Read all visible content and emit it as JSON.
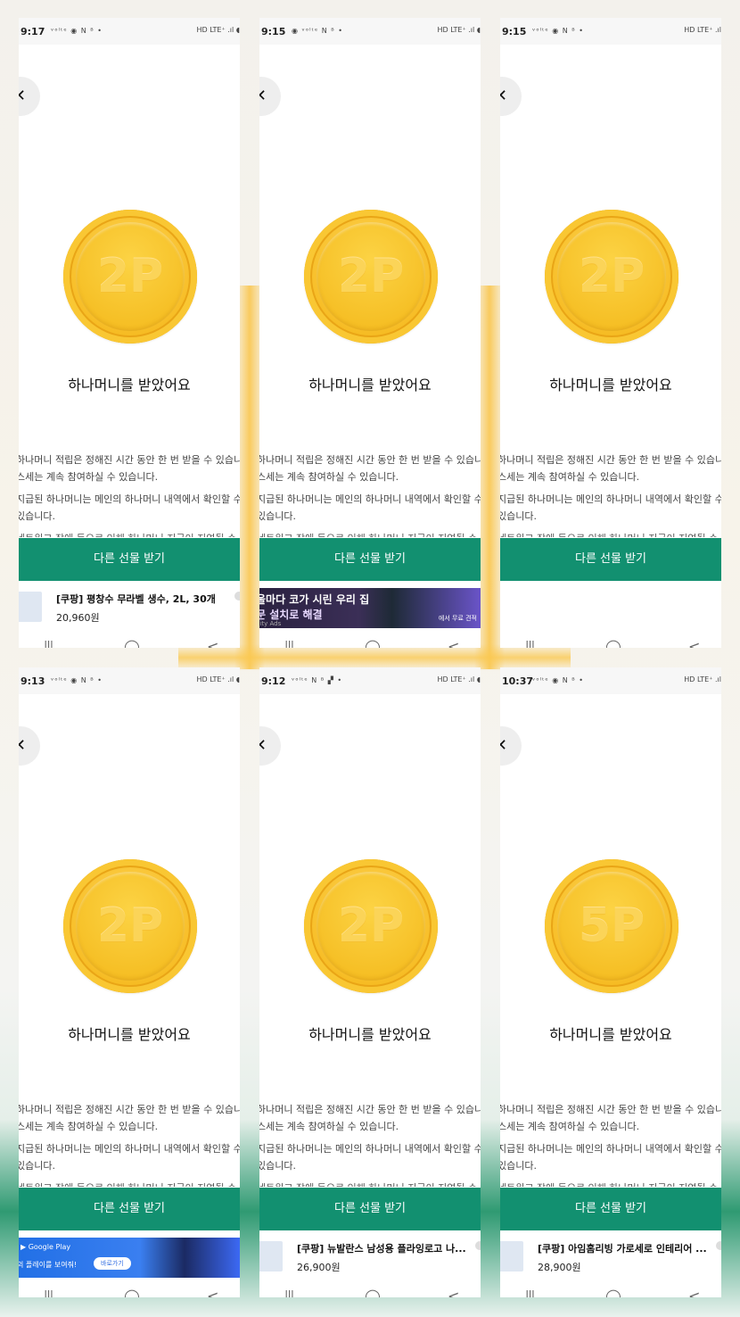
{
  "panels": [
    {
      "time": "9:17",
      "status_icons": "ᵛᵒˡᵗᵉ ◉ N ᴮ  •",
      "status_right": "HD LTE⁺ .ıl ◖",
      "close_icon": "✕",
      "coin_label": "2P",
      "headline": "하나머니를 받았어요",
      "body": [
        "하나머니 적립은 정해진 시간 동안 한 번 받을 수 있습니",
        "스세는 계속 참여하실 수 있습니다.",
        "지급된 하나머니는 메인의 하나머니 내역에서 확인할 수",
        "있습니다.",
        "네트워크 장애 등으로 인해 하나머니 지급이 지연될 수"
      ],
      "button": "다른 선물 받기",
      "ad": {
        "kind": "product",
        "name": "[쿠팡] 평창수 무라벨 생수, 2L, 30개",
        "price": "20,960원"
      },
      "nav": [
        "|||",
        "◯",
        "<"
      ]
    },
    {
      "time": "9:15",
      "status_icons": "◉ ᵛᵒˡᵗᵉ N ᴮ  •",
      "status_right": "HD LTE⁺ .ıl ◖",
      "close_icon": "✕",
      "coin_label": "2P",
      "headline": "하나머니를 받았어요",
      "body": [
        "하나머니 적립은 정해진 시간 동안 한 번 받을 수 있습니",
        "스세는 계속 참여하실 수 있습니다.",
        "지급된 하나머니는 메인의 하나머니 내역에서 확인할 수",
        "있습니다.",
        "네트워크 장애 등으로 인해 하나머니 지급이 지연될 수"
      ],
      "button": "다른 선물 받기",
      "ad": {
        "kind": "banner-dark",
        "line1": "울마다 코가 시린 우리 집",
        "line2": "문 설치로 해결",
        "line3": "nity Ads",
        "line4": "에서 무료 견적"
      },
      "nav": [
        "|||",
        "◯",
        "<"
      ]
    },
    {
      "time": "9:15",
      "status_icons": "ᵛᵒˡᵗᵉ ◉ N ᴮ  •",
      "status_right": "HD LTE⁺ .ıl",
      "close_icon": "✕",
      "coin_label": "2P",
      "headline": "하나머니를 받았어요",
      "body": [
        "하나머니 적립은 정해진 시간 동안 한 번 받을 수 있습니",
        "스세는 계속 참여하실 수 있습니다.",
        "지급된 하나머니는 메인의 하나머니 내역에서 확인할 수",
        "있습니다.",
        "네트워크 장애 등으로 인해 하나머니 지급이 지연될 수"
      ],
      "button": "다른 선물 받기",
      "ad": {
        "kind": "none"
      },
      "nav": [
        "|||",
        "◯",
        "<"
      ]
    },
    {
      "time": "9:13",
      "status_icons": "ᵛᵒˡᵗᵉ ◉ N ᴮ  •",
      "status_right": "HD LTE⁺ .ıl ◖",
      "close_icon": "✕",
      "coin_label": "2P",
      "headline": "하나머니를 받았어요",
      "body": [
        "하나머니 적립은 정해진 시간 동안 한 번 받을 수 있습니",
        "스세는 계속 참여하실 수 있습니다.",
        "지급된 하나머니는 메인의 하나머니 내역에서 확인할 수",
        "있습니다.",
        "네트워크 장애 등으로 인해 하나머니 지급이 지연될 수"
      ],
      "button": "다른 선물 받기",
      "ad": {
        "kind": "banner-game",
        "line1": "▶ Google Play",
        "line2": "의 플레이를 보여줘!",
        "cta": "바로가기"
      },
      "nav": [
        "|||",
        "◯",
        "<"
      ]
    },
    {
      "time": "9:12",
      "status_icons": "ᵛᵒˡᵗᵉ N ᴮ ▞  •",
      "status_right": "HD LTE⁺ .ıl ◖",
      "close_icon": "✕",
      "coin_label": "2P",
      "headline": "하나머니를 받았어요",
      "body": [
        "하나머니 적립은 정해진 시간 동안 한 번 받을 수 있습니",
        "스세는 계속 참여하실 수 있습니다.",
        "지급된 하나머니는 메인의 하나머니 내역에서 확인할 수",
        "있습니다.",
        "네트워크 장애 등으로 인해 하나머니 지급이 지연될 수"
      ],
      "button": "다른 선물 받기",
      "ad": {
        "kind": "product",
        "name": "[쿠팡] 뉴발란스 남성용 플라잉로고 나...",
        "price": "26,900원"
      },
      "nav": [
        "|||",
        "◯",
        "<"
      ]
    },
    {
      "time": "10:37",
      "status_icons": "ᵛᵒˡᵗᵉ ◉ N ᴮ  •",
      "status_right": "HD LTE⁺ .ıl",
      "close_icon": "✕",
      "coin_label": "5P",
      "headline": "하나머니를 받았어요",
      "body": [
        "하나머니 적립은 정해진 시간 동안 한 번 받을 수 있습니",
        "스세는 계속 참여하실 수 있습니다.",
        "지급된 하나머니는 메인의 하나머니 내역에서 확인할 수",
        "있습니다.",
        "네트워크 장애 등으로 인해 하나머니 지급이 지연될 수"
      ],
      "button": "다른 선물 받기",
      "ad": {
        "kind": "product",
        "name": "[쿠팡] 아임홈리빙 가로세로 인테리어 ...",
        "price": "28,900원"
      },
      "nav": [
        "|||",
        "◯",
        "<"
      ]
    }
  ],
  "colors": {
    "accent_green": "#129070",
    "coin_gold": "#f6bb22"
  }
}
